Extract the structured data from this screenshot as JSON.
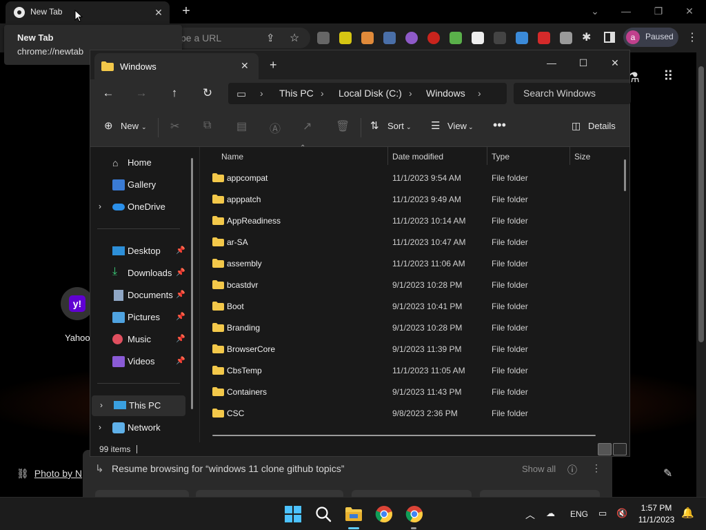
{
  "chrome": {
    "tab_title": "New Tab",
    "tooltip_title": "New Tab",
    "tooltip_url": "chrome://newtab",
    "omnibox_placeholder": "pe a URL",
    "profile_initial": "a",
    "profile_status": "Paused",
    "colors": {
      "bg": "#000000",
      "toolbar": "#1f1f1f",
      "profile_avatar": "#c0408d"
    }
  },
  "ntp": {
    "shortcut_label": "Yahoo",
    "shortcut_icon_letter": "y!",
    "photo_credit": "Photo by N",
    "resume_text": "Resume browsing for “windows 11 clone github topics”",
    "show_all": "Show all"
  },
  "explorer": {
    "tab_title": "Windows",
    "breadcrumb": [
      "This PC",
      "Local Disk (C:)",
      "Windows"
    ],
    "search_placeholder": "Search Windows",
    "commands": {
      "new": "New",
      "sort": "Sort",
      "view": "View",
      "details": "Details"
    },
    "sidebar": {
      "top": [
        "Home",
        "Gallery",
        "OneDrive"
      ],
      "quick": [
        "Desktop",
        "Downloads",
        "Documents",
        "Pictures",
        "Music",
        "Videos"
      ],
      "bottom": [
        "This PC",
        "Network"
      ]
    },
    "columns": {
      "name": "Name",
      "date": "Date modified",
      "type": "Type",
      "size": "Size"
    },
    "rows": [
      {
        "name": "appcompat",
        "date": "11/1/2023 9:54 AM",
        "type": "File folder"
      },
      {
        "name": "apppatch",
        "date": "11/1/2023 9:49 AM",
        "type": "File folder"
      },
      {
        "name": "AppReadiness",
        "date": "11/1/2023 10:14 AM",
        "type": "File folder"
      },
      {
        "name": "ar-SA",
        "date": "11/1/2023 10:47 AM",
        "type": "File folder"
      },
      {
        "name": "assembly",
        "date": "11/1/2023 11:06 AM",
        "type": "File folder"
      },
      {
        "name": "bcastdvr",
        "date": "9/1/2023 10:28 PM",
        "type": "File folder"
      },
      {
        "name": "Boot",
        "date": "9/1/2023 10:41 PM",
        "type": "File folder"
      },
      {
        "name": "Branding",
        "date": "9/1/2023 10:28 PM",
        "type": "File folder"
      },
      {
        "name": "BrowserCore",
        "date": "9/1/2023 11:39 PM",
        "type": "File folder"
      },
      {
        "name": "CbsTemp",
        "date": "11/1/2023 11:05 AM",
        "type": "File folder"
      },
      {
        "name": "Containers",
        "date": "9/1/2023 11:43 PM",
        "type": "File folder"
      },
      {
        "name": "CSC",
        "date": "9/8/2023 2:36 PM",
        "type": "File folder"
      }
    ],
    "status_count": "99 items",
    "colors": {
      "folder": "#f3c84a",
      "window_bg": "#191919",
      "bar_bg": "#2c2c2c"
    }
  },
  "taskbar": {
    "language": "ENG",
    "time": "1:57 PM",
    "date": "11/1/2023",
    "colors": {
      "bg": "#1c1c1c",
      "active_indicator": "#60cdff"
    }
  }
}
